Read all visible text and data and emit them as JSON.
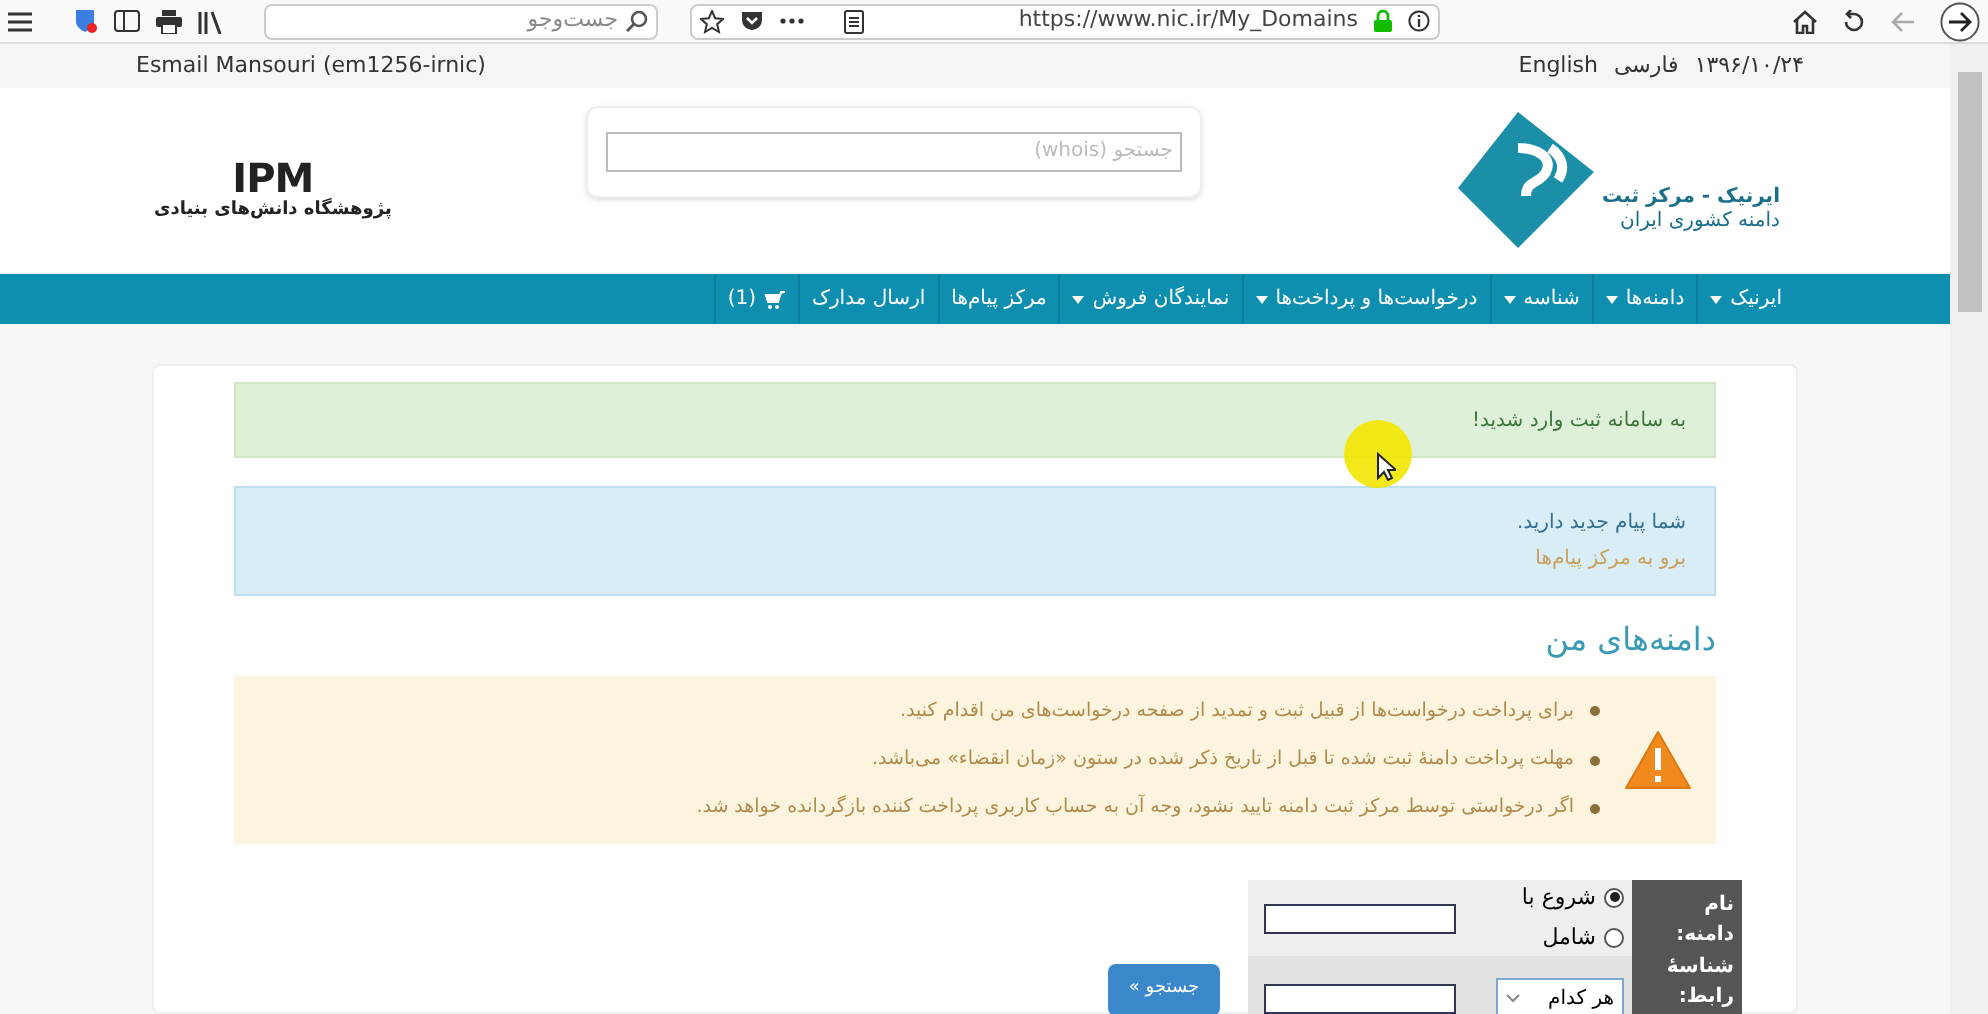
{
  "browser": {
    "search_placeholder": "جست‌وجو",
    "url": "https://www.nic.ir/My_Domains"
  },
  "top_bar": {
    "user": "Esmail Mansouri (em1256-irnic)",
    "languages": [
      "فارسی",
      "English"
    ],
    "date": "۱۳۹۶/۱۰/۲۴"
  },
  "header": {
    "logo_title": "ایرنیک - مرکز ثبت",
    "logo_subtitle": "دامنه کشوری ایران",
    "whois_placeholder": "جستجو (whois)",
    "partner_logo": "IPM",
    "partner_name": "پژوهشگاه دانش‌های بنیادی"
  },
  "nav": [
    {
      "label": "ایرنیک",
      "kind": "dropdown"
    },
    {
      "label": "دامنه‌ها",
      "kind": "dropdown"
    },
    {
      "label": "شناسه",
      "kind": "dropdown"
    },
    {
      "label": "درخواست‌ها و پرداخت‌ها",
      "kind": "dropdown"
    },
    {
      "label": "نمایندگان فروش",
      "kind": "dropdown"
    },
    {
      "label": "مرکز پیام‌ها",
      "kind": "link"
    },
    {
      "label": "ارسال مدارک",
      "kind": "link"
    },
    {
      "label": "(1)",
      "kind": "cart"
    }
  ],
  "alerts": [
    {
      "kind": "success",
      "text": "به سامانه ثبت وارد شدید!"
    },
    {
      "kind": "info",
      "text": "شما پیام جدید دارید.",
      "link": "برو به مرکز پیام‌ها"
    }
  ],
  "heading": "دامنه‌های من",
  "notices": [
    "برای پرداخت درخواست‌ها از قبیل ثبت و تمدید از صفحه درخواست‌های من اقدام کنید.",
    "مهلت پرداخت دامنهٔ ثبت شده تا قبل از تاریخ ذکر شده در ستون «زمان انقضاء» می‌باشد.",
    "اگر درخواستی توسط مرکز ثبت دامنه تایید نشود، وجه آن به حساب کاربری پرداخت کننده بازگردانده خواهد شد."
  ],
  "search_form": {
    "domain_label": "نام دامنه:",
    "match_options": [
      {
        "label": "شروع با",
        "selected": true
      },
      {
        "label": "شامل",
        "selected": false
      }
    ],
    "contact_label": "شناسهٔ رابط:",
    "contact_select": "هر کدام",
    "button": "جستجو »"
  }
}
